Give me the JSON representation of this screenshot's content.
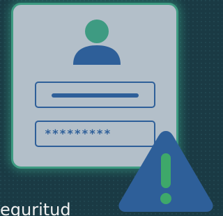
{
  "login_card": {
    "avatar_icon": "user-avatar-icon",
    "username_field": {
      "value_indicator": "bar"
    },
    "password_field": {
      "value": "*********"
    }
  },
  "warning": {
    "icon": "warning-triangle-icon"
  },
  "footer": {
    "text": "eguritud"
  },
  "colors": {
    "background": "#1a3a44",
    "card": "#b3bfc9",
    "card_border": "#3e9b82",
    "avatar_head": "#3e9b82",
    "accent_blue": "#2e5f99",
    "warning_fill": "#2e5f99",
    "warning_mark": "#3ea86a"
  }
}
